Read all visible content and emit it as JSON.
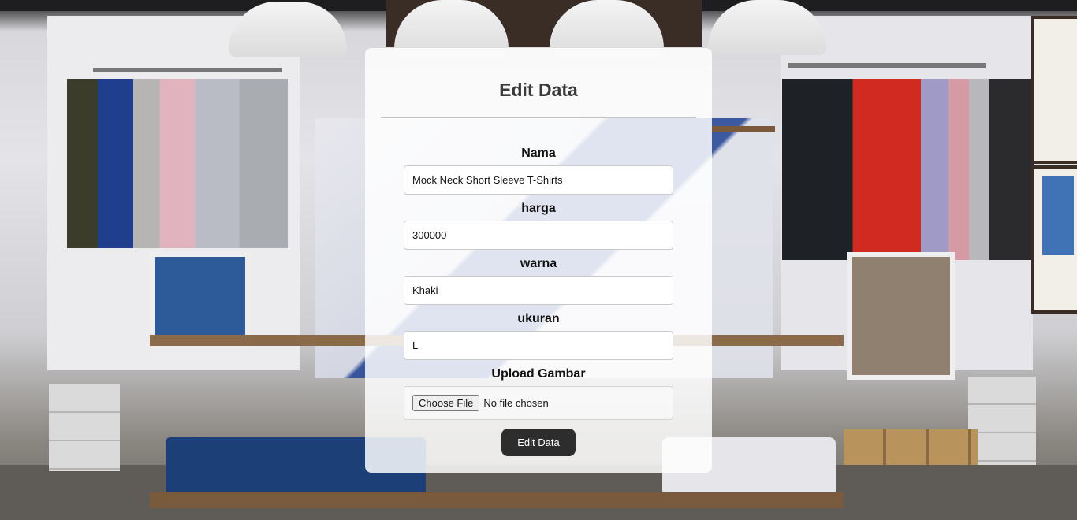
{
  "form": {
    "title": "Edit Data",
    "fields": [
      {
        "label": "Nama",
        "value": "Mock Neck Short Sleeve T-Shirts"
      },
      {
        "label": "harga",
        "value": "300000"
      },
      {
        "label": "warna",
        "value": "Khaki"
      },
      {
        "label": "ukuran",
        "value": "L"
      }
    ],
    "upload": {
      "label": "Upload Gambar",
      "button_label": "Choose File",
      "status": "No file chosen"
    },
    "submit_label": "Edit Data"
  },
  "colors": {
    "submit_bg": "#2d2d2d",
    "card_bg": "rgba(255,255,255,0.84)"
  }
}
